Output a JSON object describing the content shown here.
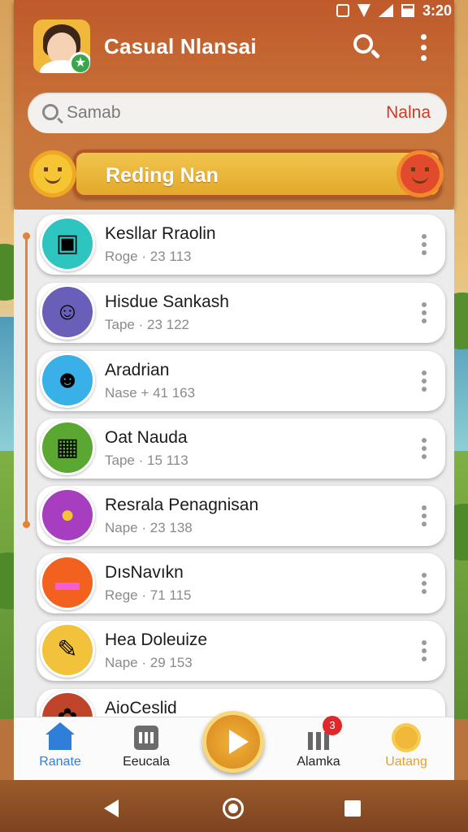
{
  "status_bar": {
    "time": "3:20"
  },
  "header": {
    "title": "Casual Nlansai"
  },
  "search": {
    "placeholder": "Samab",
    "filter_label": "Nalna"
  },
  "banner": {
    "label": "Reding Nan"
  },
  "contacts": [
    {
      "name": "Kesllar Rraolin",
      "type": "Roge",
      "number": "· 23 113",
      "icon": "framed-photo-icon",
      "color": "#2ec4c0"
    },
    {
      "name": "Hisdue Sankash",
      "type": "Tape",
      "number": "· 23 122",
      "icon": "man-with-mug-icon",
      "color": "#6a5fb8"
    },
    {
      "name": "Aradrian",
      "type": "Nase",
      "number": "+ 41 163",
      "icon": "bald-man-icon",
      "color": "#3ab0e8"
    },
    {
      "name": "Oat Nauda",
      "type": "Tape",
      "number": "· 15 113",
      "icon": "calculator-icon",
      "color": "#5aa832"
    },
    {
      "name": "Resrala Penagnisan",
      "type": "Nape",
      "number": "· 23 138",
      "icon": "yellow-blob-icon",
      "color": "#a73ec0"
    },
    {
      "name": "DısNavıkn",
      "type": "Rege",
      "number": "· 71 115",
      "icon": "pink-chat-icon",
      "color": "#f2621e"
    },
    {
      "name": "Hea Doleuize",
      "type": "Nape",
      "number": "· 29 153",
      "icon": "note-pad-icon",
      "color": "#f2c23a"
    },
    {
      "name": "AioCeslid",
      "type": "",
      "number": "",
      "icon": "candy-icon",
      "color": "#c0442a"
    }
  ],
  "bottom_nav": {
    "items": [
      {
        "label": "Ranate",
        "icon": "house-icon"
      },
      {
        "label": "Eeucala",
        "icon": "device-icon"
      },
      {
        "label": "",
        "icon": "play-icon"
      },
      {
        "label": "Alamka",
        "icon": "bar-chart-icon",
        "badge": "3"
      },
      {
        "label": "Uatang",
        "icon": "sun-coin-icon"
      }
    ]
  },
  "colors": {
    "header": "#c0622f",
    "accent": "#e3a12a",
    "nav_active": "#2f7fd8",
    "badge": "#e0282a"
  }
}
